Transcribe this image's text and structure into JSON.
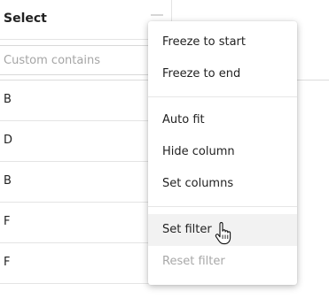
{
  "column": {
    "header_title": "Select",
    "filter_placeholder": "Custom contains",
    "filter_value": "",
    "rows": [
      "B",
      "D",
      "B",
      "F",
      "F"
    ]
  },
  "context_menu": {
    "items": [
      {
        "label": "Freeze to start",
        "state": "normal"
      },
      {
        "label": "Freeze to end",
        "state": "normal"
      },
      {
        "label": "Auto fit",
        "state": "normal"
      },
      {
        "label": "Hide column",
        "state": "normal"
      },
      {
        "label": "Set columns",
        "state": "normal"
      },
      {
        "label": "Set filter",
        "state": "hovered"
      },
      {
        "label": "Reset filter",
        "state": "disabled"
      }
    ]
  },
  "cursor": {
    "icon": "hand-pointer-icon"
  }
}
